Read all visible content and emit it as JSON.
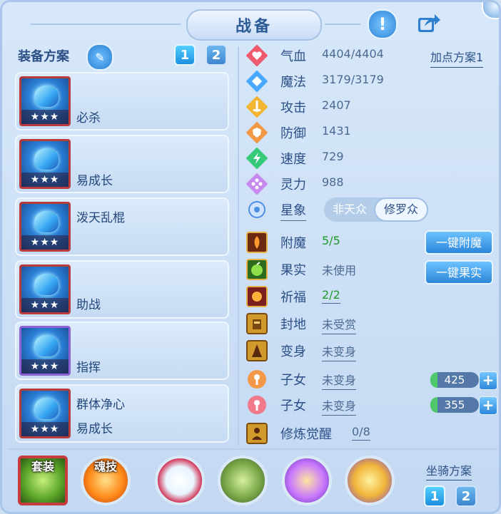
{
  "title": "战备",
  "header_icons": [
    "exclamation-icon",
    "share-icon"
  ],
  "equip": {
    "header": "装备方案",
    "tabs": [
      "1",
      "2"
    ],
    "active_tab": "1",
    "items": [
      {
        "name": "必杀",
        "extra": "",
        "stars": "★★★",
        "frame": "red"
      },
      {
        "name": "易成长",
        "extra": "",
        "stars": "★★★",
        "frame": "red"
      },
      {
        "name": "泼天乱棍",
        "extra": "",
        "stars": "★★★",
        "frame": "red"
      },
      {
        "name": "助战",
        "extra": "",
        "stars": "★★★",
        "frame": "red"
      },
      {
        "name": "指挥",
        "extra": "",
        "stars": "★★★",
        "frame": "purple"
      },
      {
        "name": "群体净心",
        "extra": "易成长",
        "stars": "★★★",
        "frame": "red"
      }
    ]
  },
  "points_plan": "加点方案1",
  "stats": [
    {
      "label": "气血",
      "value": "4404/4404",
      "icon": "heart-icon"
    },
    {
      "label": "魔法",
      "value": "3179/3179",
      "icon": "mana-icon"
    },
    {
      "label": "攻击",
      "value": "2407",
      "icon": "sword-icon"
    },
    {
      "label": "防御",
      "value": "1431",
      "icon": "shield-icon"
    },
    {
      "label": "速度",
      "value": "729",
      "icon": "speed-icon"
    },
    {
      "label": "灵力",
      "value": "988",
      "icon": "spirit-icon"
    }
  ],
  "star_sign": {
    "label": "星象",
    "options": [
      "非天众",
      "修罗众"
    ],
    "selected": "修罗众"
  },
  "extras": {
    "enchant": {
      "label": "附魔",
      "value": "5/5",
      "button": "一键附魔"
    },
    "fruit": {
      "label": "果实",
      "value": "未使用",
      "button": "一键果实"
    },
    "bless": {
      "label": "祈福",
      "value": "2/2"
    },
    "fief": {
      "label": "封地",
      "value": "未受赏"
    },
    "transform": {
      "label": "变身",
      "value": "未变身"
    },
    "child1": {
      "label": "子女",
      "value": "未变身",
      "bar": "425"
    },
    "child2": {
      "label": "子女",
      "value": "未变身",
      "bar": "355"
    },
    "awaken": {
      "label": "修炼觉醒",
      "value": "0/8"
    }
  },
  "bottom": {
    "set_label": "套装",
    "soul_label": "魂技",
    "mount_label": "坐骑方案",
    "mount_tabs": [
      "1",
      "2"
    ],
    "mount_active": "1"
  },
  "colors": {
    "accent": "#2c86d8",
    "good": "#1f9a2a",
    "text": "#2b4f86"
  }
}
